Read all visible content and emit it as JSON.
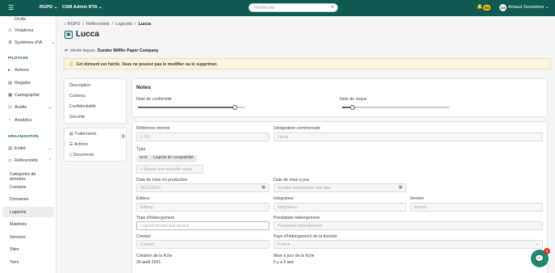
{
  "topbar": {
    "nav1": "RGPD",
    "nav2": "CSM Admin RTA",
    "search_placeholder": "Rechercher",
    "notif_count": "54",
    "avatar_initials": "AG",
    "user_name": "Arnaud Gosselove"
  },
  "sidebar": {
    "top_items": [
      "Droits",
      "Violations",
      "Systèmes d'IA"
    ],
    "section_pilotage": "PILOTAGE",
    "pilotage_items": [
      "Actions",
      "Registre",
      "Cartographie",
      "Audits",
      "Analytics"
    ],
    "section_organisation": "ORGANISATION",
    "org_items": [
      "Entité",
      "Référentiels"
    ],
    "sub_items": [
      "Catégories de données",
      "Contacts",
      "Domaines",
      "Logiciels",
      "Matériels",
      "Services",
      "Sites",
      "Tiers"
    ]
  },
  "breadcrumb": {
    "root": "RGPD",
    "level1": "Référentiels",
    "level2": "Logiciels",
    "current": "Lucca"
  },
  "page": {
    "title": "Lucca",
    "inherit_label": "Hérité depuis",
    "inherit_company": "Dunder Mifflin Paper Company",
    "alert_text": "Cet élément est hérité. Vous ne pouvez pas le modifier ou le supprimer."
  },
  "left_nav": {
    "items": [
      "Description",
      "Contenu",
      "Confidentialité",
      "Sécurité"
    ],
    "items2": [
      "Traitements",
      "Actions",
      "Documents"
    ],
    "traitements_count": "2"
  },
  "notes": {
    "title": "Notes",
    "conformite_label": "Note de conformité",
    "conformite_value": 0.9,
    "risque_label": "Note de risque",
    "risque_value": 0.1
  },
  "form": {
    "ref_label": "Référence interne",
    "ref_value": "L.001",
    "designation_label": "Désignation commerciale",
    "designation_value": "Lucca",
    "type_label": "Type",
    "type_tags": [
      "SAS",
      "Logiciel de comptabilité"
    ],
    "add_value_placeholder": "Ajouter une nouvelle valeur",
    "mep_label": "Date de mise en production",
    "mep_value": "02/11/2010",
    "maj_label": "Date de mise à jour",
    "maj_placeholder": "Veuillez sélectionner une date",
    "editeur_label": "Éditeur",
    "editeur_placeholder": "Éditeur",
    "integrateur_label": "Intégrateur",
    "integrateur_placeholder": "Intégrateur",
    "version_label": "Version",
    "version_placeholder": "Version",
    "hebergement_label": "Type d'hébergement",
    "hebergement_value": "Logiciel en tant que service",
    "presta_label": "Prestataire hébergement",
    "presta_placeholder": "Prestataire hébergement",
    "contact_label": "Contact",
    "contact_placeholder": "Contact",
    "pays_label": "Pays d'hébergement de la donnée",
    "pays_value": "France",
    "creation_label": "Création de la fiche",
    "creation_value": "20 août 2021",
    "miseajour_label": "Mise à jour de la fiche",
    "miseajour_value": "Il y a 3 ans"
  },
  "chat": {
    "unread": "1"
  }
}
